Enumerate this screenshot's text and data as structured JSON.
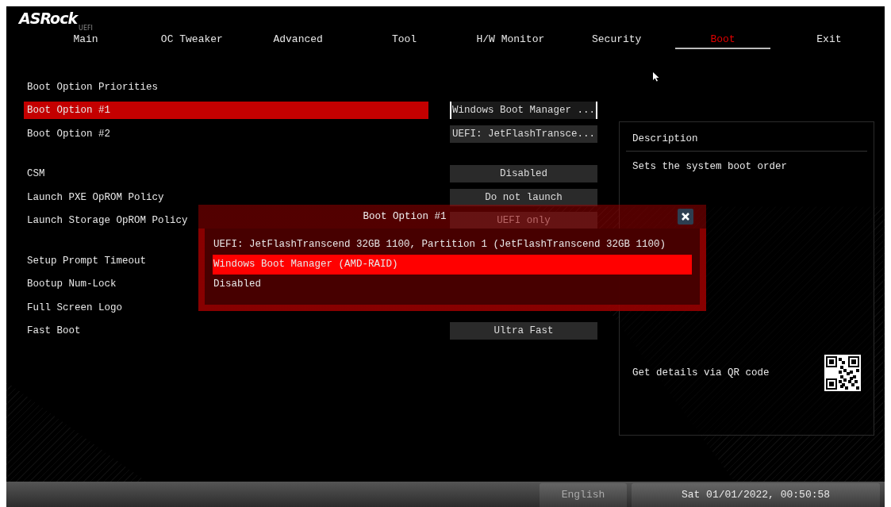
{
  "logo": {
    "brand": "ASRock",
    "sub": "UEFI"
  },
  "tabs": [
    {
      "label": "Main",
      "selected": false
    },
    {
      "label": "OC Tweaker",
      "selected": false
    },
    {
      "label": "Advanced",
      "selected": false
    },
    {
      "label": "Tool",
      "selected": false
    },
    {
      "label": "H/W Monitor",
      "selected": false
    },
    {
      "label": "Security",
      "selected": false
    },
    {
      "label": "Boot",
      "selected": true
    },
    {
      "label": "Exit",
      "selected": false
    }
  ],
  "settings": [
    {
      "kind": "heading",
      "label": "Boot Option Priorities"
    },
    {
      "kind": "option",
      "label": "Boot Option #1",
      "value": "Windows Boot Manager ...",
      "selected": true
    },
    {
      "kind": "option",
      "label": "Boot Option #2",
      "value": "UEFI: JetFlashTransce...",
      "selected": false
    },
    {
      "kind": "spacer"
    },
    {
      "kind": "option",
      "label": "CSM",
      "value": "Disabled",
      "selected": false
    },
    {
      "kind": "option",
      "label": "Launch PXE OpROM Policy",
      "value": "Do not launch",
      "selected": false
    },
    {
      "kind": "option",
      "label": "Launch Storage OpROM Policy",
      "value": "UEFI only",
      "selected": false
    },
    {
      "kind": "spacer"
    },
    {
      "kind": "option",
      "label": "Setup Prompt Timeout",
      "selected": false
    },
    {
      "kind": "option",
      "label": "Bootup Num-Lock",
      "selected": false
    },
    {
      "kind": "option",
      "label": "Full Screen Logo",
      "selected": false
    },
    {
      "kind": "option",
      "label": "Fast Boot",
      "value": "Ultra Fast",
      "selected": false
    }
  ],
  "description": {
    "title": "Description",
    "text": "Sets the system boot order",
    "qr_text": "Get details via QR code"
  },
  "dialog": {
    "title": "Boot Option #1",
    "options": [
      {
        "label": "UEFI: JetFlashTranscend 32GB 1100, Partition 1 (JetFlashTranscend 32GB 1100)",
        "selected": false
      },
      {
        "label": "Windows Boot Manager (AMD-RAID)",
        "selected": true
      },
      {
        "label": "Disabled",
        "selected": false
      }
    ]
  },
  "status_bar": {
    "language": "English",
    "datetime": "Sat 01/01/2022, 00:50:58"
  }
}
